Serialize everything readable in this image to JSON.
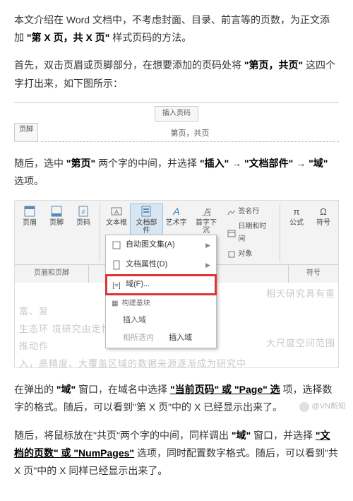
{
  "para1": {
    "t1": "本文介绍在 Word 文档中，不考虑封面、目录、前言等的页数，为正文添加",
    "b1": "\"第 X 页，共 X 页\"",
    "t2": "样式页码的方法。"
  },
  "para2": {
    "t1": "首先，双击页眉或页脚部分，在想要添加的页码处将",
    "b1": "\"第页，共页\"",
    "t2": "这四个字打出来，如下图所示："
  },
  "shot1": {
    "insert_btn": "插入页码",
    "tag": "页脚",
    "center_text": "第页，共页"
  },
  "para3": {
    "t1": "随后，选中",
    "b1": "\"第页\"",
    "t2": "两个字的中间，并选择",
    "b2": "\"插入\"",
    "arrow1": "→",
    "b3": "\"文档部件\"",
    "arrow2": "→",
    "b4": "\"域\"",
    "t3": "选项。"
  },
  "ribbon": {
    "btns": [
      "页眉",
      "页脚",
      "页码",
      "文本框",
      "文档部件",
      "艺术字",
      "首字下沉"
    ],
    "side": [
      "签名行",
      "日期和时间",
      "对象"
    ],
    "right": [
      "公式",
      "符号"
    ],
    "group_left": "页眉和页脚",
    "group_right": "符号"
  },
  "menu": {
    "i1": "自动图文集(A)",
    "i2": "文档属性(D)",
    "i3": "域(F)...",
    "head": "构建基块",
    "s1": "插入域",
    "s2": "相所选内",
    "s2b": "插入域"
  },
  "doc_bg": "富、复\n生态环                                境研究由定性到\n推动作\n入，高精度、大覆盖区域的数据来源逐渐成为研究中",
  "doc_bg_r1": "相天研究具有重",
  "doc_bg_r2": "大尺度空间范围",
  "para4": {
    "t1": "在弹出的",
    "b1": "\"域\"",
    "t2": "窗口，在域名中选择",
    "b2": "\"当前页码\" 或 \"Page\" 选",
    "t3": "项，选择数字的格式。随后，可以看到\"第 X 页\"中的 X 已经显示出来了。"
  },
  "para5": {
    "t1": "随后，将鼠标放在\"共页\"两个字的中间，同样调出",
    "b1": "\"域\"",
    "t2": "窗口，并选择",
    "b2": "\"文档的页数\" 或 \"NumPages\"",
    "t3": "选项，同时配置数字格式。随后，可以看到\"共 X 页\"中的 X 同样已经显示出来了。"
  },
  "watermark": "@VN新知"
}
